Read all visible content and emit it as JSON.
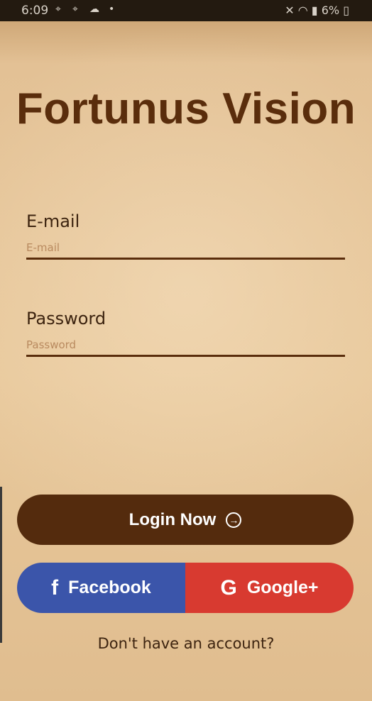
{
  "status_bar": {
    "time": "6:09",
    "battery": "6%",
    "icons": [
      "screenshot-icon",
      "screenshot-icon",
      "cloud-icon",
      "dot-icon",
      "mute-icon",
      "wifi-icon",
      "signal-icon",
      "battery-icon"
    ]
  },
  "app": {
    "title": "Fortunus Vision"
  },
  "email": {
    "label": "E-mail",
    "placeholder": "E-mail",
    "value": ""
  },
  "password": {
    "label": "Password",
    "placeholder": "Password",
    "value": ""
  },
  "login_button": {
    "label": "Login Now",
    "icon": "arrow-right-circle-icon"
  },
  "social": {
    "facebook_label": "Facebook",
    "facebook_icon": "facebook-icon",
    "google_label": "Google+",
    "google_icon": "google-icon"
  },
  "signup_link": "Don't have an account?",
  "colors": {
    "brand_brown": "#542b0d",
    "facebook_blue": "#3b55aa",
    "google_red": "#d83a30",
    "background": "#e4c294"
  }
}
